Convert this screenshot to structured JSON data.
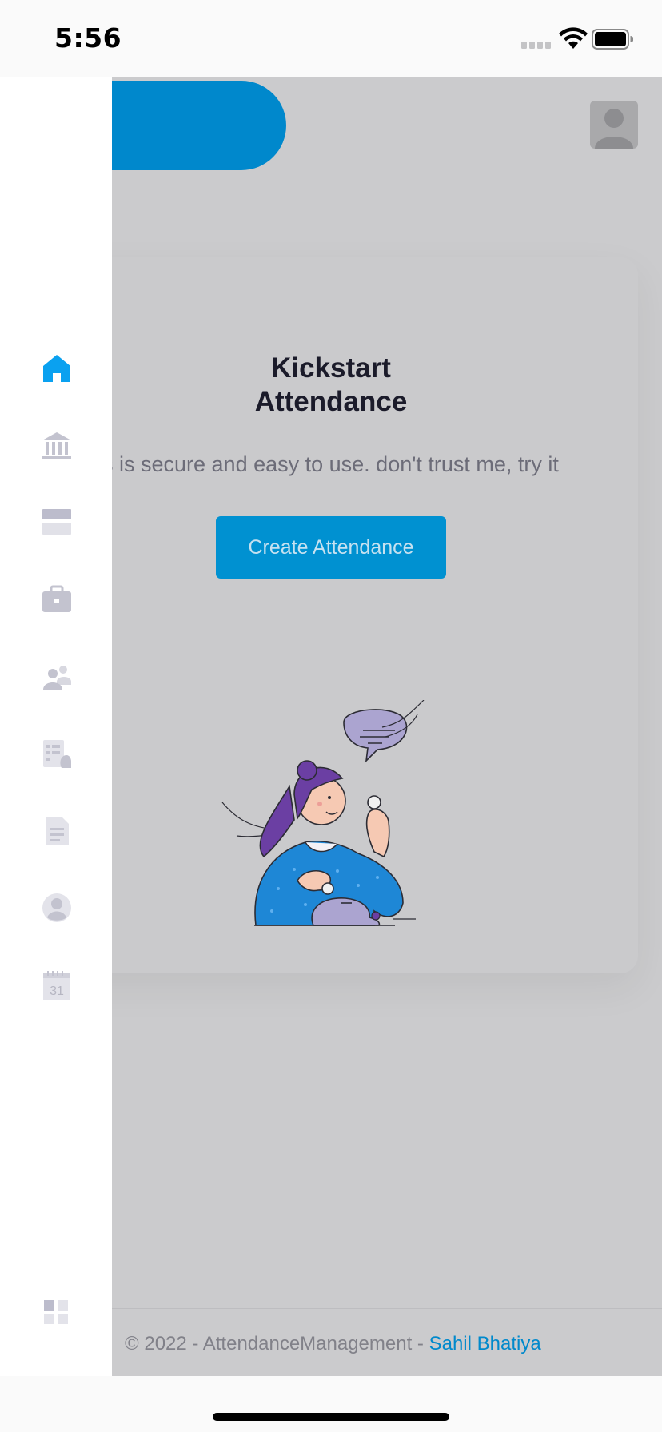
{
  "status_bar": {
    "time": "5:56",
    "icons": [
      "signal-icon",
      "wifi-icon",
      "battery-icon"
    ]
  },
  "header": {
    "avatar": "user-avatar-icon"
  },
  "drawer": {
    "items": [
      {
        "name": "home",
        "icon": "home-icon",
        "active": true
      },
      {
        "name": "institution",
        "icon": "bank-icon",
        "active": false
      },
      {
        "name": "cards",
        "icon": "card-icon",
        "active": false
      },
      {
        "name": "work",
        "icon": "briefcase-icon",
        "active": false
      },
      {
        "name": "people",
        "icon": "users-icon",
        "active": false
      },
      {
        "name": "tasks",
        "icon": "checklist-icon",
        "active": false
      },
      {
        "name": "documents",
        "icon": "document-icon",
        "active": false
      },
      {
        "name": "profile",
        "icon": "user-circle-icon",
        "active": false
      },
      {
        "name": "calendar",
        "icon": "calendar-icon",
        "active": false,
        "label": "31"
      }
    ],
    "bottom_icon": "grid-icon"
  },
  "card": {
    "title_line1": "Kickstart",
    "title_line2": "Attendance",
    "subtitle": "s is secure and easy to use. don't trust me, try it",
    "button_label": "Create Attendance"
  },
  "footer": {
    "text": "© 2022 - AttendanceManagement - ",
    "link": "Sahil Bhatiya"
  },
  "colors": {
    "accent": "#0088cc",
    "overlay": "#cbcbcd",
    "active_icon": "#0aa1f0",
    "inactive_icon": "#c3c3cf"
  }
}
